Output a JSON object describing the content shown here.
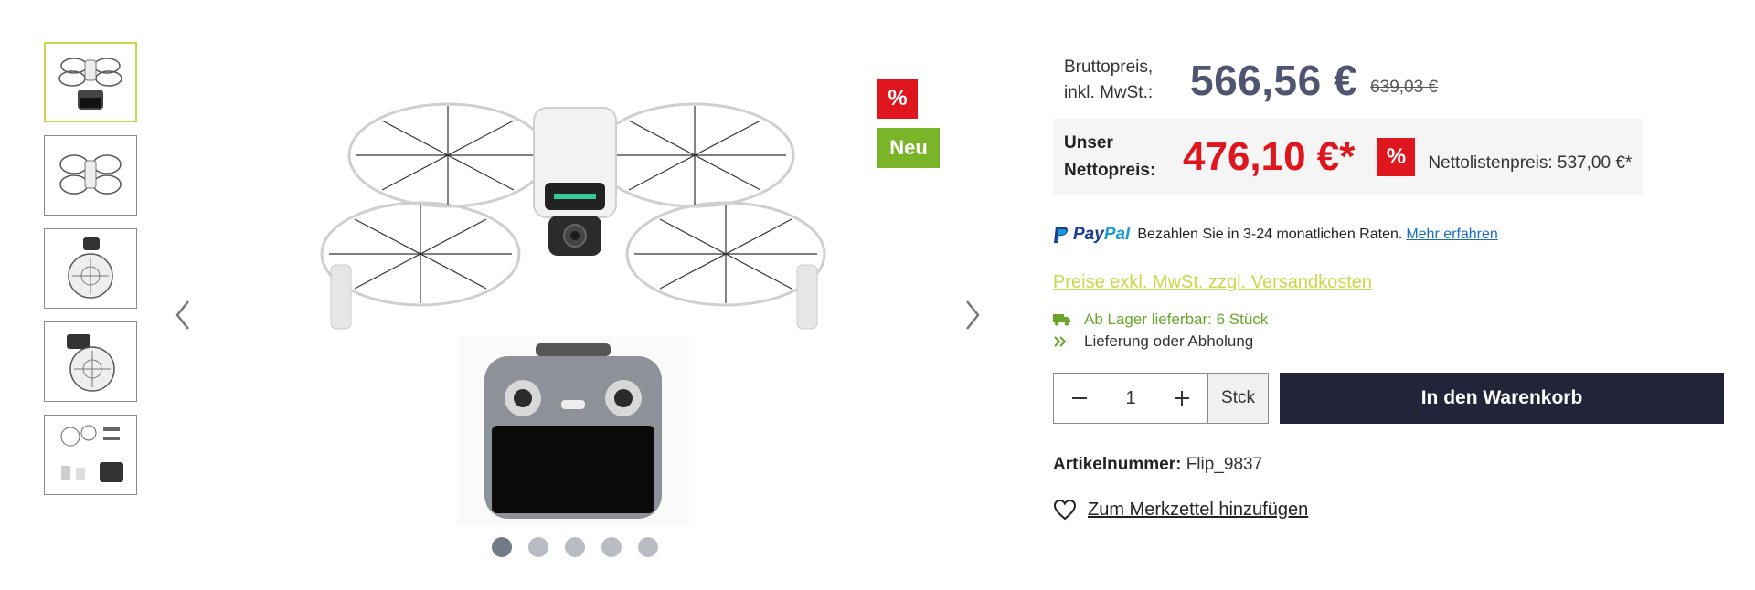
{
  "gallery": {
    "thumbnails": [
      {
        "alt": "Drohne mit Fernsteuerung"
      },
      {
        "alt": "Drohne Draufsicht"
      },
      {
        "alt": "Drohne gefaltet Seite"
      },
      {
        "alt": "Drohne gefaltet hinten"
      },
      {
        "alt": "Lieferumfang"
      }
    ],
    "active_thumbnail": 0,
    "badges": {
      "discount": "%",
      "new": "Neu"
    },
    "dots_count": 5,
    "active_dot": 0
  },
  "pricing": {
    "gross_label_line1": "Bruttopreis,",
    "gross_label_line2": "inkl. MwSt.:",
    "gross_price": "566,56 €",
    "gross_old_price": "639,03 €",
    "net_label_line1": "Unser",
    "net_label_line2": "Nettopreis:",
    "net_price": "476,10 €*",
    "net_badge": "%",
    "net_list_label": "Nettolistenpreis:",
    "net_list_price": "537,00 €*"
  },
  "paypal": {
    "word_part1": "Pay",
    "word_part2": "Pal",
    "text": "Bezahlen Sie in 3-24 monatlichen Raten.",
    "link": "Mehr erfahren"
  },
  "shipping_link": "Preise exkl. MwSt. zzgl. Versandkosten",
  "stock_text": "Ab Lager lieferbar: 6 Stück",
  "delivery_text": "Lieferung oder Abholung",
  "quantity": {
    "value": "1",
    "unit": "Stck"
  },
  "cart_button": "In den Warenkorb",
  "sku": {
    "label": "Artikelnummer:",
    "value": "Flip_9837"
  },
  "wishlist": "Zum Merkzettel hinzufügen",
  "colors": {
    "accent_green": "#7ab428",
    "sale_red": "#e0161e",
    "cart_dark": "#222539",
    "price_gray_blue": "#4f5470",
    "link_lime": "#c9d84a"
  }
}
